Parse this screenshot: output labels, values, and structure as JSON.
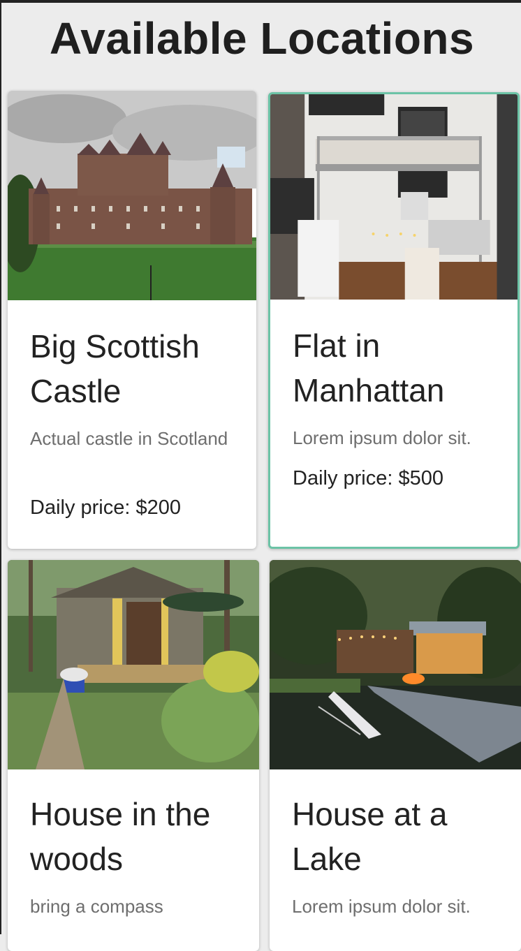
{
  "page": {
    "title": "Available Locations"
  },
  "locations": [
    {
      "title": "Big Scottish Castle",
      "description": "Actual castle in Scotland",
      "price": "Daily price: $200",
      "image": "castle-photo"
    },
    {
      "title": "Flat in Manhattan",
      "description": "Lorem ipsum dolor sit.",
      "price": "Daily price: $500",
      "image": "loft-apartment-photo",
      "selected": true
    },
    {
      "title": "House in the woods",
      "description": "bring a compass",
      "price": "",
      "image": "forest-cabin-photo"
    },
    {
      "title": "House at a Lake",
      "description": "Lorem ipsum dolor sit.",
      "price": "",
      "image": "lake-house-photo"
    }
  ],
  "colors": {
    "selected_border": "#6cc3a6",
    "background": "#ececec"
  }
}
